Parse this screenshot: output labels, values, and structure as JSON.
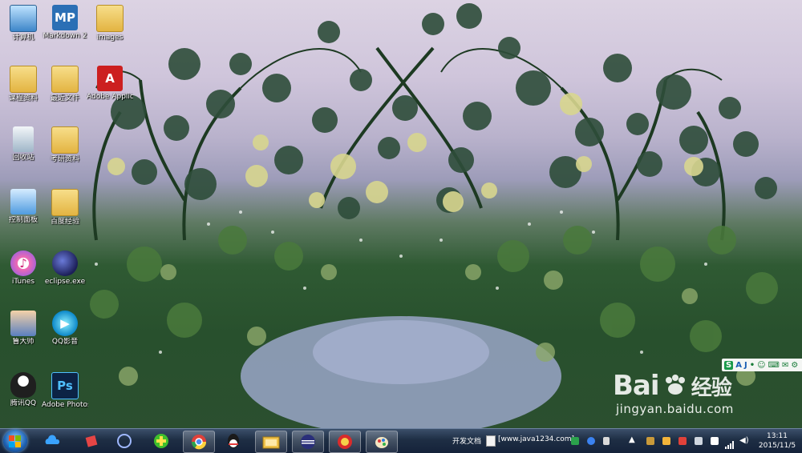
{
  "desktop": {
    "icons": [
      {
        "label": "计算机",
        "icon": "computer-icon"
      },
      {
        "label": "Markdown 2",
        "icon": "markdownpad-icon"
      },
      {
        "label": "images",
        "icon": "folder-icon"
      },
      {
        "label": "课程资料",
        "icon": "folder-icon"
      },
      {
        "label": "最近文件",
        "icon": "folder-icon"
      },
      {
        "label": "Adobe Applicati...",
        "icon": "adobe-icon"
      },
      {
        "label": "回收站",
        "icon": "recycle-bin-icon"
      },
      {
        "label": "考研资料",
        "icon": "folder-icon"
      },
      {
        "label": "控制面板",
        "icon": "control-panel-icon"
      },
      {
        "label": "百度经验",
        "icon": "folder-icon"
      },
      {
        "label": "iTunes",
        "icon": "itunes-icon"
      },
      {
        "label": "eclipse.exe",
        "icon": "eclipse-icon"
      },
      {
        "label": "鲁大师",
        "icon": "ludashi-icon"
      },
      {
        "label": "QQ影音",
        "icon": "qqplayer-icon"
      },
      {
        "label": "腾讯QQ",
        "icon": "qq-icon"
      },
      {
        "label": "Adobe Photosh...",
        "icon": "photoshop-icon"
      }
    ]
  },
  "watermark": {
    "brand_left": "Bai",
    "brand_right": "经验",
    "site": "jingyan.baidu.com"
  },
  "ime_bar": {
    "items": [
      "S",
      "A",
      "J",
      "•",
      "☺",
      "⌨",
      "✉",
      "⚙"
    ]
  },
  "taskbar": {
    "pinned": [
      {
        "name": "start-button"
      },
      {
        "name": "baidu-cloud-icon"
      },
      {
        "name": "youdao-icon"
      },
      {
        "name": "eclipse-pinned-icon"
      },
      {
        "name": "360-icon"
      },
      {
        "name": "chrome-icon"
      },
      {
        "name": "qq-pinned-icon"
      },
      {
        "name": "explorer-icon"
      },
      {
        "name": "eclipse-running-icon"
      },
      {
        "name": "ludashi-pinned-icon"
      },
      {
        "name": "paint-icon"
      }
    ],
    "running_label_1": "开发文档",
    "running_label_2": "[www.java1234.com].",
    "clock_time": "13:11",
    "clock_date": "2015/11/5"
  }
}
